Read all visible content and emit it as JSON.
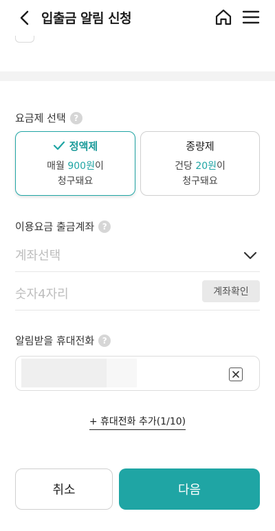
{
  "header": {
    "title": "입출금 알림 신청"
  },
  "plan_section": {
    "label": "요금제 선택",
    "help": "?",
    "plans": [
      {
        "name": "정액제",
        "line1_prefix": "매월 ",
        "line1_value": "900원",
        "line1_suffix": "이",
        "line2": "청구돼요",
        "selected": true
      },
      {
        "name": "종량제",
        "line1_prefix": "건당 ",
        "line1_value": "20원",
        "line1_suffix": "이",
        "line2": "청구돼요",
        "selected": false
      }
    ]
  },
  "account_section": {
    "label": "이용요금 출금계좌",
    "help": "?",
    "account_placeholder": "계좌선택",
    "pin_placeholder": "숫자4자리",
    "verify_button": "계좌확인"
  },
  "phone_section": {
    "label": "알림받을 휴대전화",
    "help": "?",
    "add_link": "+ 휴대전화 추가(1/10)"
  },
  "footer": {
    "cancel": "취소",
    "next": "다음"
  },
  "colors": {
    "accent": "#1fa5a4"
  }
}
